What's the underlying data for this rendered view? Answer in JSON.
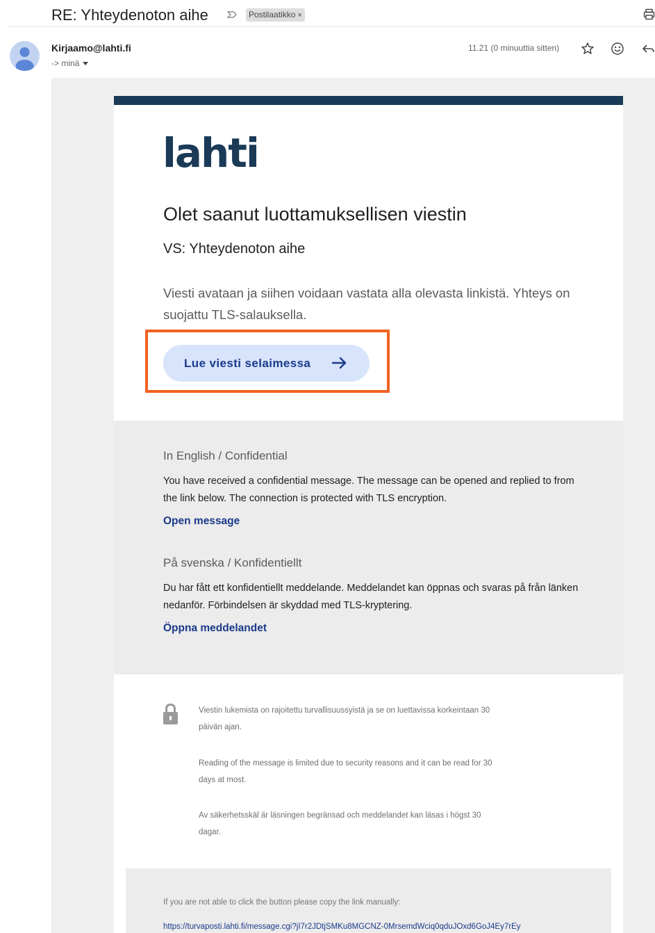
{
  "thread": {
    "subject": "RE: Yhteydenoton aihe",
    "label": "Postilaatikko",
    "label_remove": "×"
  },
  "message_header": {
    "sender": "Kirjaamo@lahti.fi",
    "recipient": "-> minä",
    "time": "11.21 (0 minuuttia sitten)"
  },
  "icons": {
    "importance": "importance-marker-icon",
    "print": "print-icon",
    "avatar": "default-avatar-icon",
    "star": "star-icon",
    "emoji": "emoji-reaction-icon",
    "reply": "reply-icon",
    "cta_arrow": "arrow-right-icon",
    "lock": "lock-icon"
  },
  "email": {
    "logo_text": "lahti",
    "heading": "Olet saanut luottamuksellisen viestin",
    "subject_line": "VS: Yhteydenoton aihe",
    "intro": "Viesti avataan ja siihen voidaan vastata alla olevasta linkistä. Yhteys on suojattu TLS-salauksella.",
    "cta_label": "Lue viesti selaimessa",
    "english": {
      "heading": "In English / Confidential",
      "body": "You have received a confidential message. The message can be opened and replied to from the link below. The connection is protected with TLS encryption.",
      "link": "Open message"
    },
    "swedish": {
      "heading": "På svenska / Konfidentiellt",
      "body": "Du har fått ett konfidentiellt meddelande. Meddelandet kan öppnas och svaras på från länken nedanför. Förbindelsen är skyddad med TLS-kryptering.",
      "link": "Öppna meddelandet"
    },
    "notices": [
      "Viestin lukemista on rajoitettu turvallisuussyistä ja se on luettavissa korkeintaan 30 päivän ajan.",
      "Reading of the message is limited due to security reasons and it can be read for 30 days at most.",
      "Av säkerhetsskäl är läsningen begränsad och meddelandet kan läsas i högst 30 dagar."
    ],
    "manual_text": "If you are not able to click the button please copy the link manually:",
    "manual_url": "https://turvaposti.lahti.fi/message.cgi?jI7r2JDtjSMKu8MGCNZ-0MrsemdWciq0qduJOxd6GoJ4Ey7rEy"
  },
  "colors": {
    "brand_navy": "#1a3a57",
    "cta_bg": "#d8e4fb",
    "link": "#1a3a8a",
    "highlight": "#f26222"
  }
}
